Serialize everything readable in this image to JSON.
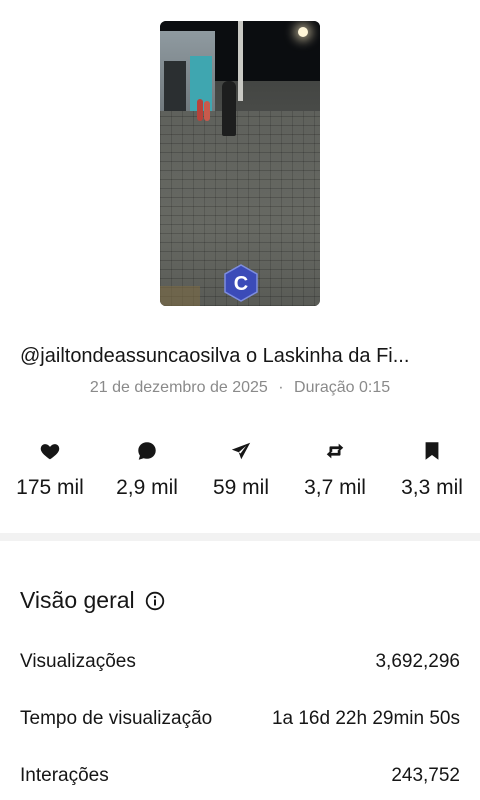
{
  "video": {
    "badge_letter": "C",
    "title": "@jailtondeassuncaosilva o Laskinha da Fi...",
    "date": "21 de dezembro de 2025",
    "separator": "·",
    "duration": "Duração 0:15"
  },
  "stats": [
    {
      "icon": "heart-icon",
      "value": "175 mil"
    },
    {
      "icon": "comment-icon",
      "value": "2,9 mil"
    },
    {
      "icon": "share-icon",
      "value": "59 mil"
    },
    {
      "icon": "repost-icon",
      "value": "3,7 mil"
    },
    {
      "icon": "bookmark-icon",
      "value": "3,3 mil"
    }
  ],
  "overview": {
    "title": "Visão geral",
    "rows": [
      {
        "label": "Visualizações",
        "value": "3,692,296"
      },
      {
        "label": "Tempo de visualização",
        "value": "1a 16d 22h 29min 50s"
      },
      {
        "label": "Interações",
        "value": "243,752"
      }
    ]
  },
  "colors": {
    "text": "#161616",
    "muted": "#8a8a8a",
    "divider": "#f2f2f2",
    "badge": "#3b4bb8"
  }
}
